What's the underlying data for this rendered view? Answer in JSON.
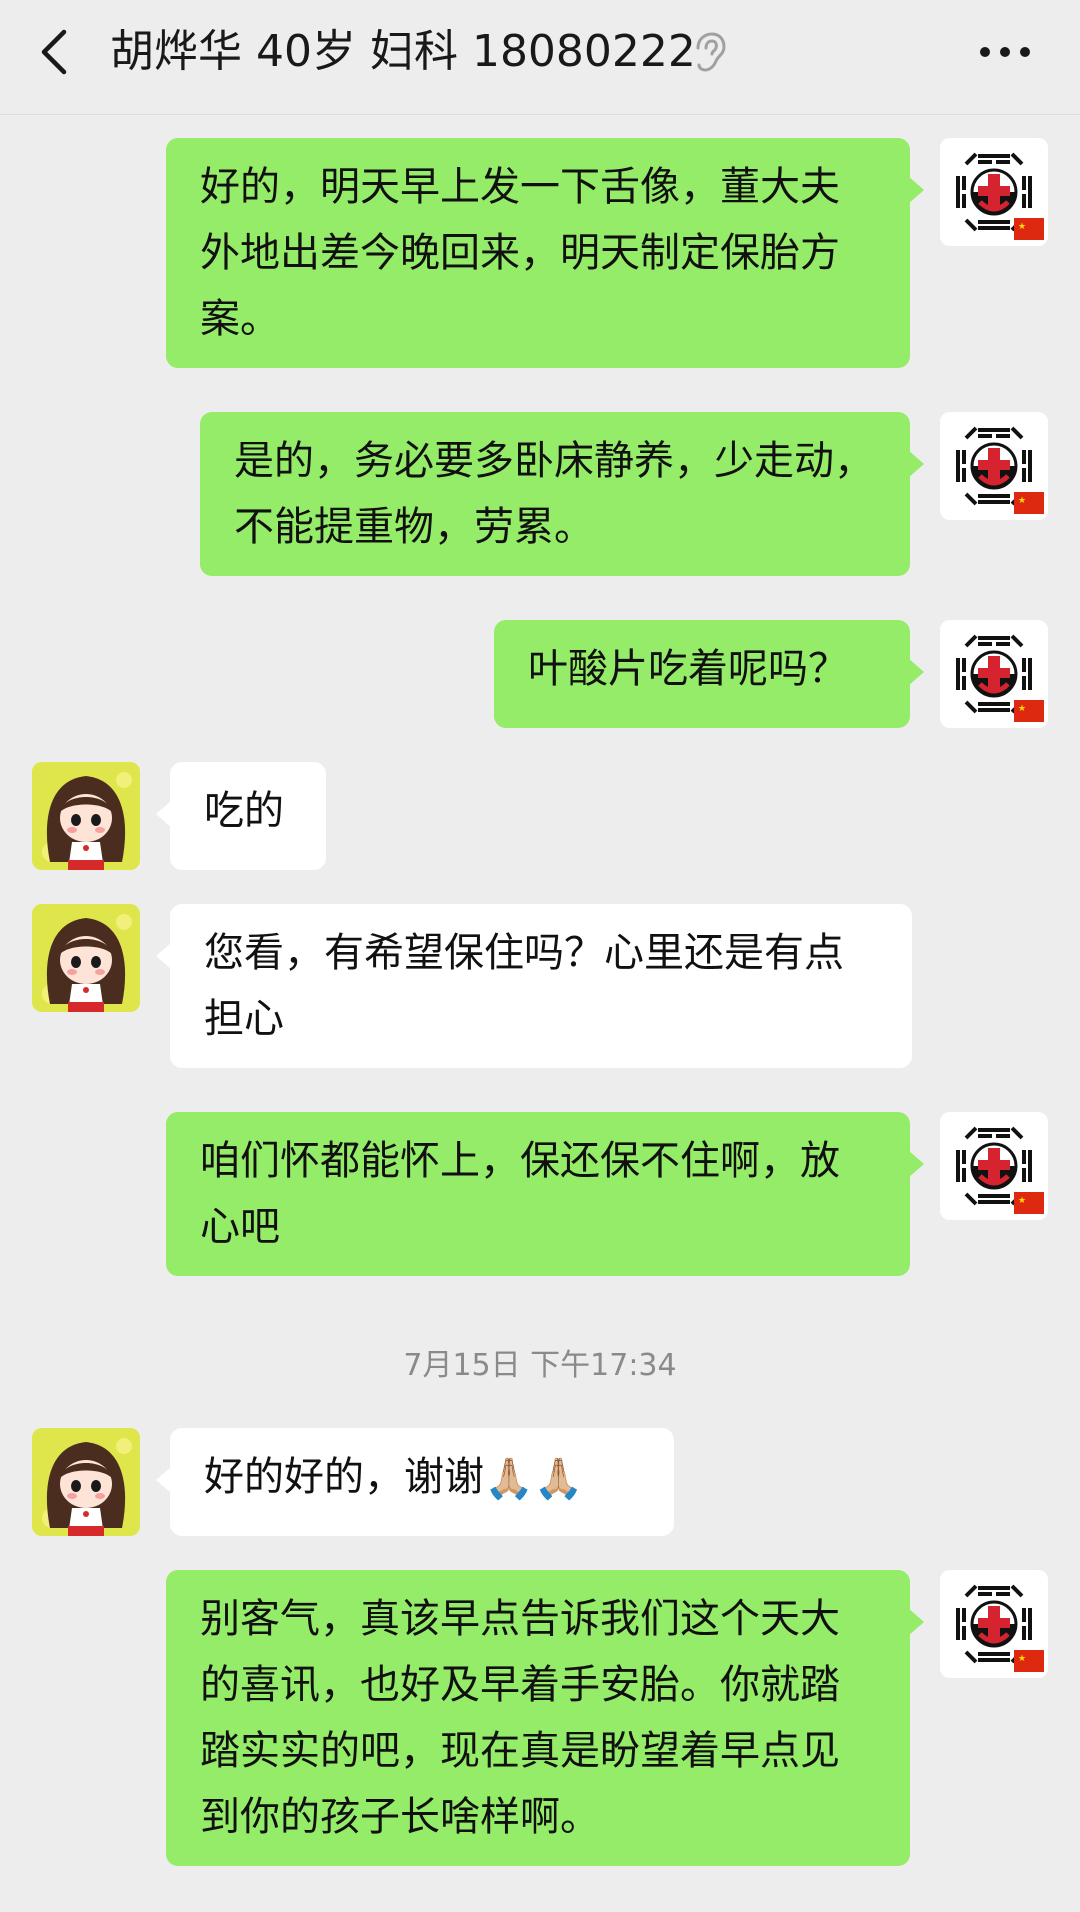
{
  "header": {
    "title": "胡烨华 40岁 妇科 18080222",
    "back_icon": "chevron-left-icon",
    "ear_icon": "ear-icon",
    "more_icon": "more-dots-icon"
  },
  "messages": [
    {
      "from": "me",
      "text": "好的，明天早上发一下舌像，董大夫外地出差今晚回来，明天制定保胎方案。"
    },
    {
      "from": "me",
      "text": "是的，务必要多卧床静养，少走动，不能提重物，劳累。"
    },
    {
      "from": "me",
      "text": "叶酸片吃着呢吗？"
    },
    {
      "from": "them",
      "text": "吃的"
    },
    {
      "from": "them",
      "text": "您看，有希望保住吗？心里还是有点担心"
    },
    {
      "from": "me",
      "text": "咱们怀都能怀上，保还保不住啊，放心吧"
    },
    {
      "timestamp": "7月15日 下午17:34"
    },
    {
      "from": "them",
      "text": "好的好的，谢谢",
      "emoji": "🙏🏼🙏🏼"
    },
    {
      "from": "me",
      "text": "别客气，真该早点告诉我们这个天大的喜讯，也好及早着手安胎。你就踏踏实实的吧，现在真是盼望着早点见到你的孩子长啥样啊。"
    }
  ],
  "colors": {
    "background": "#ededed",
    "my_bubble": "#95ec69",
    "their_bubble": "#ffffff"
  }
}
